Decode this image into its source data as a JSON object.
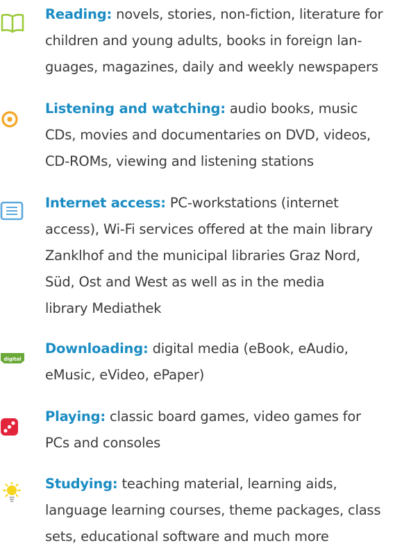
{
  "colors": {
    "heading": "#1a8cc3",
    "body": "#3a3a3a",
    "book_icon": "#9ccb3b",
    "disc_icon": "#f5a623",
    "monitor_icon": "#5aa8dd",
    "digital_icon": "#6aa838",
    "dice_icon": "#e3253c",
    "sun_icon": "#f6d51c"
  },
  "items": [
    {
      "icon": "book-icon",
      "title": "Reading:",
      "lines": [
        " novels, stories, non-fiction, literature for",
        "children and young adults, books in foreign lan-",
        "guages, magazines, daily and weekly newspapers"
      ]
    },
    {
      "icon": "disc-icon",
      "title": "Listening and watching:",
      "lines": [
        " audio books, music",
        "CDs, movies and documentaries on DVD, videos,",
        "CD-ROMs, viewing and listening stations"
      ]
    },
    {
      "icon": "monitor-icon",
      "title": "Internet access:",
      "lines": [
        " PC-workstations (internet",
        "access), Wi-Fi services offered at the main library",
        "Zanklhof and the municipal libraries Graz Nord,",
        "Süd, Ost and West as well as in the media",
        "library Mediathek"
      ]
    },
    {
      "icon": "digital-icon",
      "icon_label": "digital",
      "title": "Downloading:",
      "lines": [
        " digital media (eBook, eAudio,",
        "eMusic, eVideo, ePaper)"
      ]
    },
    {
      "icon": "dice-icon",
      "title": "Playing:",
      "lines": [
        " classic board games, video games for",
        "PCs and consoles"
      ]
    },
    {
      "icon": "sun-icon",
      "title": "Studying:",
      "lines": [
        " teaching material, learning aids,",
        "language learning courses, theme packages, class",
        "sets, educational software and much more"
      ]
    }
  ]
}
